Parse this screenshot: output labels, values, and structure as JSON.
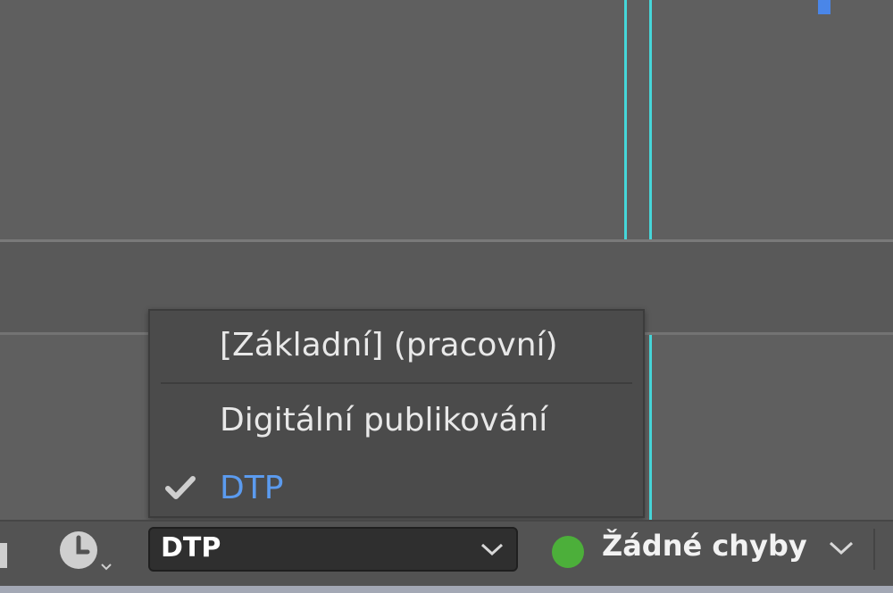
{
  "menu": {
    "items": [
      {
        "label": "[Základní] (pracovní)",
        "checked": false
      },
      {
        "label": "Digitální publikování",
        "checked": false
      },
      {
        "label": "DTP",
        "checked": true
      }
    ]
  },
  "status_bar": {
    "history_icon": "clock-history-icon",
    "workspace_value": "DTP",
    "preflight_status": "Žádné chyby",
    "preflight_status_color": "#4caf3a"
  },
  "colors": {
    "guide": "#46d6d9",
    "accent_selected": "#5b9bef",
    "menu_bg": "#4b4b4b",
    "canvas_bg": "#5f5f5f"
  }
}
